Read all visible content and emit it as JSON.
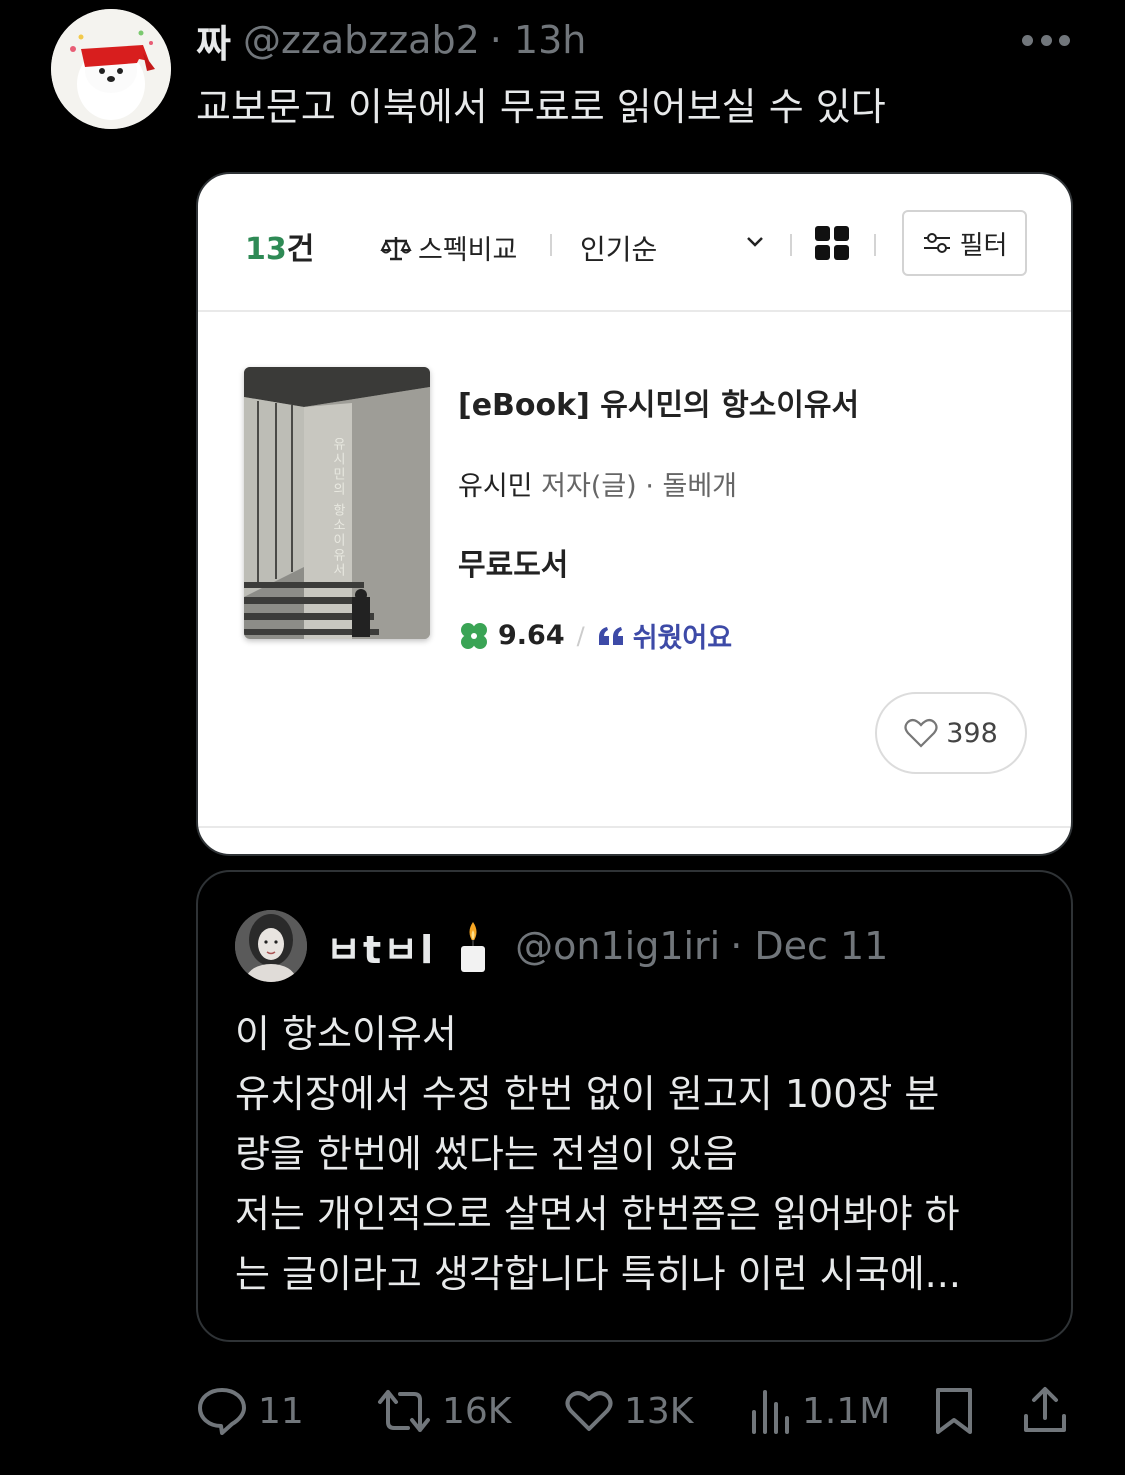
{
  "post": {
    "display_name": "짜",
    "handle": "@zzabzzab2",
    "time": "· 13h",
    "text": "교보문고 이북에서 무료로 읽어보실 수 있다"
  },
  "card": {
    "count_num": "13",
    "count_unit": "건",
    "compare_label": "스펙비교",
    "sort_label": "인기순",
    "filter_label": "필터",
    "book_title": "[eBook] 유시민의 항소이유서",
    "author": "유시민",
    "author_role": "저자(글)",
    "publisher_sep": "·",
    "publisher": "돌베개",
    "price": "무료도서",
    "score": "9.64",
    "slash": "/",
    "review_tag": "쉬웠어요",
    "likes": "398",
    "cover_title": "유시민의 항소이유서",
    "colors": {
      "green": "#2e8a55",
      "blue": "#3d4aa7"
    }
  },
  "quote": {
    "display_name": "ㅂtㅂl",
    "handle": "@on1ig1iri",
    "time": "· Dec 11",
    "lines": [
      "이 항소이유서",
      "유치장에서 수정 한번 없이 원고지 100장 분",
      "량을 한번에 썼다는 전설이 있음",
      "저는 개인적으로 살면서 한번쯤은 읽어봐야 하",
      "는 글이라고 생각합니다 특히나 이런 시국에..."
    ]
  },
  "actions": {
    "replies": "11",
    "reposts": "16K",
    "likes": "13K",
    "views": "1.1M"
  }
}
